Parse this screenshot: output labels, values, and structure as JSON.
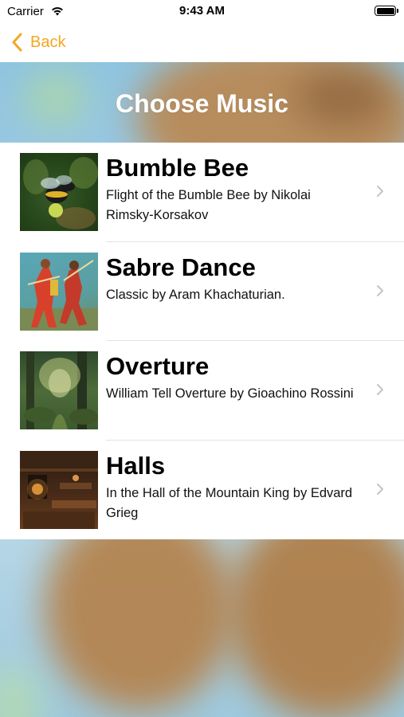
{
  "status_bar": {
    "carrier": "Carrier",
    "time": "9:43 AM"
  },
  "nav": {
    "back_label": "Back"
  },
  "page": {
    "title": "Choose Music"
  },
  "colors": {
    "accent": "#f5a623"
  },
  "music_items": [
    {
      "title": "Bumble Bee",
      "subtitle": "Flight of the Bumble Bee by Nikolai Rimsky-Korsakov",
      "thumbnail_icon": "bumble-bee-painting"
    },
    {
      "title": "Sabre Dance",
      "subtitle": "Classic by Aram Khachaturian.",
      "thumbnail_icon": "sabre-dancers-painting"
    },
    {
      "title": "Overture",
      "subtitle": "William Tell Overture by Gioachino Rossini",
      "thumbnail_icon": "forest-painting"
    },
    {
      "title": "Halls",
      "subtitle": "In the Hall of the Mountain King by Edvard Grieg",
      "thumbnail_icon": "mountain-hall-painting"
    }
  ]
}
